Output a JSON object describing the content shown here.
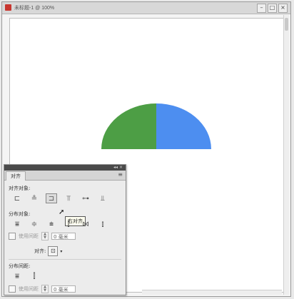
{
  "window": {
    "title": "未标题-1 @ 100%",
    "controls": [
      "–",
      "□",
      "×"
    ]
  },
  "artwork": {
    "shape": "semicircle",
    "colors": {
      "left_half": "#4d9e45",
      "right_half": "#4d8ef0"
    }
  },
  "align_panel": {
    "tab_label": "对齐",
    "menu_icon": "panel-menu-icon",
    "sections": {
      "align_objects": {
        "label": "对齐对象:"
      },
      "distribute_objects": {
        "label": "分布对象:"
      },
      "align_to": {
        "label": "对齐:"
      },
      "distribute_spacing": {
        "label": "分布间距:"
      }
    },
    "align_object_icons": [
      "horizontal-align-left-icon",
      "horizontal-align-center-icon",
      "horizontal-align-right-icon",
      "vertical-align-top-icon",
      "vertical-align-center-icon",
      "vertical-align-bottom-icon"
    ],
    "distribute_object_icons": [
      "vertical-distribute-top-icon",
      "vertical-distribute-center-icon",
      "vertical-distribute-bottom-icon",
      "horizontal-distribute-left-icon",
      "horizontal-distribute-center-icon",
      "horizontal-distribute-right-icon"
    ],
    "tooltip": "右对齐",
    "use_spacing_label": "使用间距",
    "spacing_value": "0 毫米",
    "spacing_value_2": "0 毫米"
  }
}
